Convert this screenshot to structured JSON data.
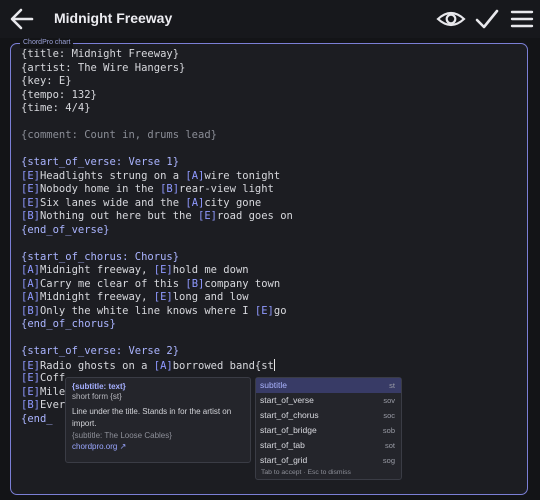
{
  "app": {
    "title": "Midnight Freeway"
  },
  "editor": {
    "label": "ChordPro chart",
    "lines": [
      [
        {
          "t": "{title: Midnight Freeway}",
          "k": "plain"
        }
      ],
      [
        {
          "t": "{artist: The Wire Hangers}",
          "k": "plain"
        }
      ],
      [
        {
          "t": "{key: E}",
          "k": "plain"
        }
      ],
      [
        {
          "t": "{tempo: 132}",
          "k": "plain"
        }
      ],
      [
        {
          "t": "{time: 4/4}",
          "k": "plain"
        }
      ],
      [],
      [
        {
          "t": "{comment: Count in, drums lead}",
          "k": "comment"
        }
      ],
      [],
      [
        {
          "t": "{start_of_verse: Verse 1}",
          "k": "directive"
        }
      ],
      [
        {
          "t": "[E]",
          "k": "chord"
        },
        {
          "t": "Headlights strung on a ",
          "k": "plain"
        },
        {
          "t": "[A]",
          "k": "chord"
        },
        {
          "t": "wire tonight",
          "k": "plain"
        }
      ],
      [
        {
          "t": "[E]",
          "k": "chord"
        },
        {
          "t": "Nobody home in the ",
          "k": "plain"
        },
        {
          "t": "[B]",
          "k": "chord"
        },
        {
          "t": "rear-view light",
          "k": "plain"
        }
      ],
      [
        {
          "t": "[E]",
          "k": "chord"
        },
        {
          "t": "Six lanes wide and the ",
          "k": "plain"
        },
        {
          "t": "[A]",
          "k": "chord"
        },
        {
          "t": "city gone",
          "k": "plain"
        }
      ],
      [
        {
          "t": "[B]",
          "k": "chord"
        },
        {
          "t": "Nothing out here but the ",
          "k": "plain"
        },
        {
          "t": "[E]",
          "k": "chord"
        },
        {
          "t": "road goes on",
          "k": "plain"
        }
      ],
      [
        {
          "t": "{end_of_verse}",
          "k": "directive"
        }
      ],
      [],
      [
        {
          "t": "{start_of_chorus: Chorus}",
          "k": "directive"
        }
      ],
      [
        {
          "t": "[A]",
          "k": "chord"
        },
        {
          "t": "Midnight freeway, ",
          "k": "plain"
        },
        {
          "t": "[E]",
          "k": "chord"
        },
        {
          "t": "hold me down",
          "k": "plain"
        }
      ],
      [
        {
          "t": "[A]",
          "k": "chord"
        },
        {
          "t": "Carry me clear of this ",
          "k": "plain"
        },
        {
          "t": "[B]",
          "k": "chord"
        },
        {
          "t": "company town",
          "k": "plain"
        }
      ],
      [
        {
          "t": "[A]",
          "k": "chord"
        },
        {
          "t": "Midnight freeway, ",
          "k": "plain"
        },
        {
          "t": "[E]",
          "k": "chord"
        },
        {
          "t": "long and low",
          "k": "plain"
        }
      ],
      [
        {
          "t": "[B]",
          "k": "chord"
        },
        {
          "t": "Only the white line knows where I ",
          "k": "plain"
        },
        {
          "t": "[E]",
          "k": "chord"
        },
        {
          "t": "go",
          "k": "plain"
        }
      ],
      [
        {
          "t": "{end_of_chorus}",
          "k": "directive"
        }
      ],
      [],
      [
        {
          "t": "{start_of_verse: Verse 2}",
          "k": "directive"
        }
      ],
      [
        {
          "t": "[E]",
          "k": "chord"
        },
        {
          "t": "Radio ghosts on a ",
          "k": "plain"
        },
        {
          "t": "[A]",
          "k": "chord"
        },
        {
          "t": "borrowed band{st",
          "k": "plain"
        }
      ],
      [
        {
          "t": "[E]",
          "k": "chord"
        },
        {
          "t": "Coff",
          "k": "plain"
        }
      ],
      [
        {
          "t": "[E]",
          "k": "chord"
        },
        {
          "t": "Mile",
          "k": "plain"
        }
      ],
      [
        {
          "t": "[B]",
          "k": "chord"
        },
        {
          "t": "Every",
          "k": "plain"
        }
      ],
      [
        {
          "t": "{end_",
          "k": "directive"
        }
      ]
    ]
  },
  "doc_popup": {
    "heading": "{subtitle: text}",
    "short_form": "short form  {st}",
    "description": "Line under the title. Stands in for the artist on import.",
    "example": "{subtitle: The Loose Cables}",
    "link": "chordpro.org ↗"
  },
  "suggestions": {
    "items": [
      {
        "name": "subtitle",
        "abbr": "st",
        "selected": true
      },
      {
        "name": "start_of_verse",
        "abbr": "sov"
      },
      {
        "name": "start_of_chorus",
        "abbr": "soc"
      },
      {
        "name": "start_of_bridge",
        "abbr": "sob"
      },
      {
        "name": "start_of_tab",
        "abbr": "sot"
      },
      {
        "name": "start_of_grid",
        "abbr": "sog"
      }
    ],
    "footer": "Tab to accept · Esc to dismiss"
  },
  "icons": [
    "back-arrow-icon",
    "eye-icon",
    "check-icon",
    "menu-icon"
  ],
  "colors": {
    "accent": "#7b7fd6",
    "chord": "#8f99ff",
    "directive": "#aab4ff",
    "background": "#131417"
  }
}
